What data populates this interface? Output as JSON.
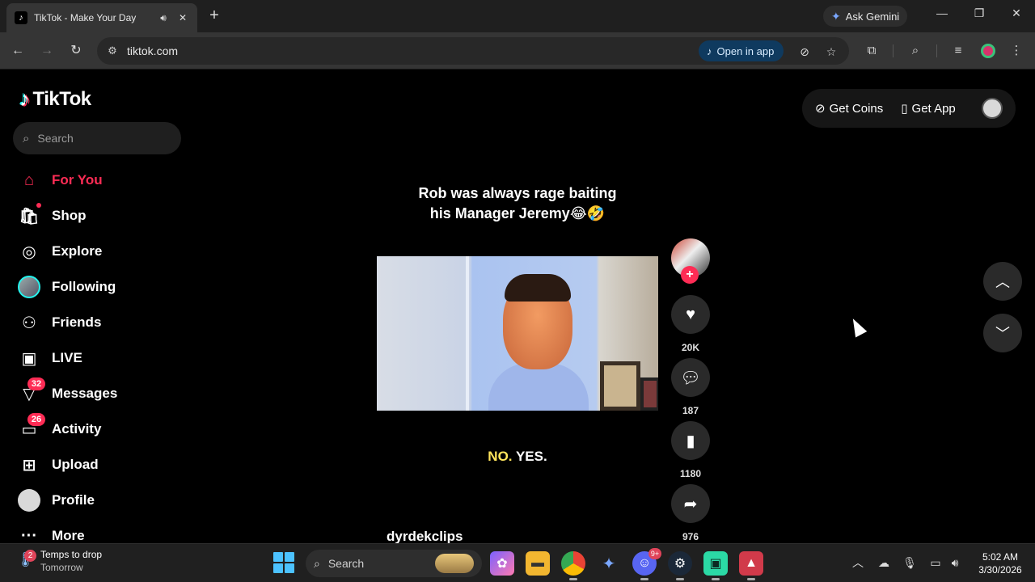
{
  "browser": {
    "tab_title": "TikTok - Make Your Day",
    "new_tab": "+",
    "ask_gemini": "Ask Gemini",
    "url": "tiktok.com",
    "open_in_app": "Open in app"
  },
  "tiktok": {
    "logo": "TikTok",
    "search_placeholder": "Search",
    "nav": [
      {
        "label": "For You",
        "icon": "home-icon"
      },
      {
        "label": "Shop",
        "icon": "shop-bag-icon"
      },
      {
        "label": "Explore",
        "icon": "compass-icon"
      },
      {
        "label": "Following",
        "icon": "following-avatar"
      },
      {
        "label": "Friends",
        "icon": "friends-icon"
      },
      {
        "label": "LIVE",
        "icon": "live-tv-icon"
      },
      {
        "label": "Messages",
        "icon": "send-icon",
        "badge": "32"
      },
      {
        "label": "Activity",
        "icon": "activity-icon",
        "badge": "26"
      },
      {
        "label": "Upload",
        "icon": "upload-plus-icon"
      },
      {
        "label": "Profile",
        "icon": "profile-avatar"
      },
      {
        "label": "More",
        "icon": "more-dots-icon"
      }
    ],
    "get_coins": "Get Coins",
    "get_app": "Get App",
    "video": {
      "caption_line1": "Rob was always rage baiting",
      "caption_line2": "his Manager Jeremy😂🤣",
      "overlay_no": "NO.",
      "overlay_yes": "YES.",
      "author": "dyrdekclips",
      "likes": "20K",
      "comments": "187",
      "saves": "1180",
      "shares": "976"
    }
  },
  "taskbar": {
    "weather_badge": "2",
    "weather_line1": "Temps to drop",
    "weather_line2": "Tomorrow",
    "search_label": "Search",
    "discord_badge": "9+",
    "time": "5:02 AM",
    "date": "3/30/2026"
  },
  "colors": {
    "tiktok_red": "#fe2c55",
    "tiktok_cyan": "#25f4ee",
    "overlay_yellow": "#ffe55c"
  }
}
